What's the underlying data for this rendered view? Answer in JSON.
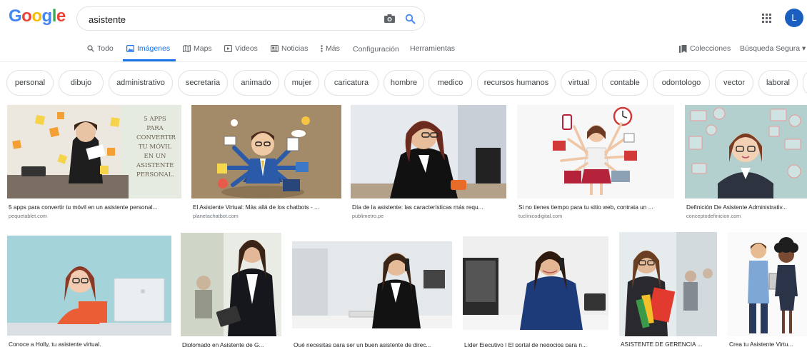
{
  "header": {
    "logo_letters": [
      "G",
      "o",
      "o",
      "g",
      "l",
      "e"
    ],
    "logo_colors": [
      "#4285F4",
      "#EA4335",
      "#FBBC05",
      "#4285F4",
      "#34A853",
      "#EA4335"
    ],
    "search_value": "asistente",
    "avatar_letter": "L"
  },
  "tabs": {
    "items": [
      {
        "label": "Todo",
        "icon": "search-icon"
      },
      {
        "label": "Imágenes",
        "icon": "image-icon"
      },
      {
        "label": "Maps",
        "icon": "map-icon"
      },
      {
        "label": "Videos",
        "icon": "video-icon"
      },
      {
        "label": "Noticias",
        "icon": "news-icon"
      },
      {
        "label": "Más",
        "icon": "more-vert-icon"
      }
    ],
    "settings": "Configuración",
    "tools": "Herramientas",
    "collections": "Colecciones",
    "safe_search": "Búsqueda Segura ▾"
  },
  "chips": [
    "personal",
    "dibujo",
    "administrativo",
    "secretaria",
    "animado",
    "mujer",
    "caricatura",
    "hombre",
    "medico",
    "recursos humanos",
    "virtual",
    "contable",
    "odontologo",
    "vector",
    "laboral"
  ],
  "results_row1": [
    {
      "caption": "5 apps para convertir tu móvil en un asistente personal...",
      "source": "pequetablet.com",
      "thumb_text": "5 APPS PARA CONVERTIR TU MÓVIL EN UN ASISTENTE PERSONAL."
    },
    {
      "caption": "El Asistente Virtual: Más allá de los chatbots - ...",
      "source": "planetachatbot.com"
    },
    {
      "caption": "Día de la asistente: las características más requ...",
      "source": "publimetro.pe"
    },
    {
      "caption": "Si no tienes tiempo para tu sitio web, contrata un ...",
      "source": "tuclinicodigital.com"
    },
    {
      "caption": "Definición De Asistente Administrativ...",
      "source": "conceptodefinicion.com"
    }
  ],
  "results_row2": [
    {
      "caption": "Conoce a Holly, tu asistente virtual."
    },
    {
      "caption": "Diplomado en Asistente de G..."
    },
    {
      "caption": "Qué necesitas para ser un buen asistente de direc..."
    },
    {
      "caption": "Líder Ejecutivo | El portal de negocios para n..."
    },
    {
      "caption": "ASISTENTE DE GERENCIA ..."
    },
    {
      "caption": "Crea tu Asistente Virtu..."
    }
  ]
}
